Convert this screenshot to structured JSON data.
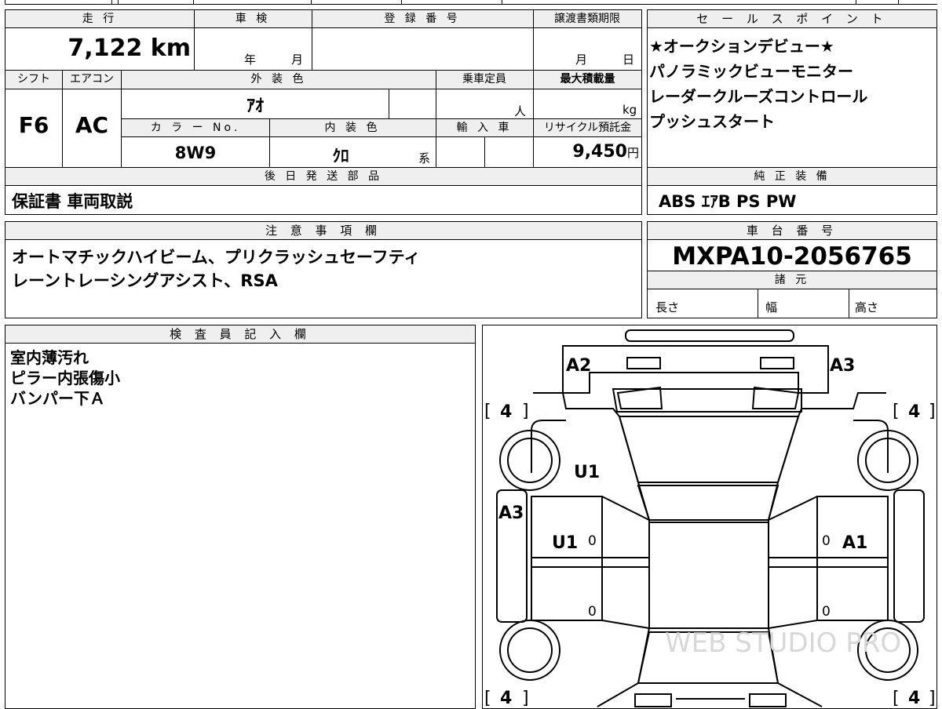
{
  "header_labels": {
    "mileage": "走 行",
    "inspection": "車 検",
    "registration": "登 録 番 号",
    "transfer_deadline": "譲渡書類期限",
    "shift": "シフト",
    "aircon": "エアコン",
    "exterior_color": "外 装 色",
    "capacity": "乗車定員",
    "max_load": "最大積載量",
    "color_no": "カ ラ ー No.",
    "interior_color": "内 装 色",
    "import": "輸 入 車",
    "recycle_fee": "リサイクル預託金",
    "later_parts": "後 日 発 送 部 品",
    "sales_points": "セ ー ル ス ポ イ ン ト",
    "genuine_equipment": "純 正 装 備",
    "notes": "注 意 事 項 欄",
    "chassis_no": "車 台 番 号",
    "specs": "諸 元",
    "inspector": "検 査 員 記 入 欄"
  },
  "values": {
    "mileage": "7,122",
    "mileage_unit": "km",
    "inspection_year": "年",
    "inspection_month": "月",
    "transfer_month": "月",
    "transfer_day": "日",
    "shift": "F6",
    "aircon": "AC",
    "exterior_color": "ｱｵ",
    "capacity_unit": "人",
    "load_unit": "kg",
    "color_no": "8W9",
    "interior_color": "ｸﾛ",
    "interior_suffix": "系",
    "recycle_fee": "9,450",
    "recycle_unit": "円",
    "later_parts": "保証書 車両取説",
    "chassis_no": "MXPA10-2056765",
    "spec_length": "長さ",
    "spec_width": "幅",
    "spec_height": "高さ"
  },
  "sales_points": [
    "★オークションデビュー★",
    "パノラミックビューモニター",
    "レーダークルーズコントロール",
    "プッシュスタート"
  ],
  "genuine_equipment": "ABS ｴｱB PS PW",
  "notes": [
    "オートマチックハイビーム、プリクラッシュセーフティ",
    "レーントレーシングアシスト、RSA"
  ],
  "inspector_notes": [
    "室内薄汚れ",
    "ピラー内張傷小",
    "バンパー下Ａ"
  ],
  "diagram": {
    "marks": {
      "front_left": "A2",
      "front_right": "A3",
      "left_fender": "U1",
      "left_side_panel": "A3",
      "left_front_door": "U1",
      "right_front_door": "A1"
    },
    "tire_labels": {
      "front_left": "4",
      "front_right": "4",
      "rear_left": "4",
      "rear_right": "4"
    },
    "door_zeros": {
      "lf": "0",
      "lr": "0",
      "rf": "0",
      "rr": "0"
    },
    "watermark": "WEB STUDIO PRO"
  }
}
